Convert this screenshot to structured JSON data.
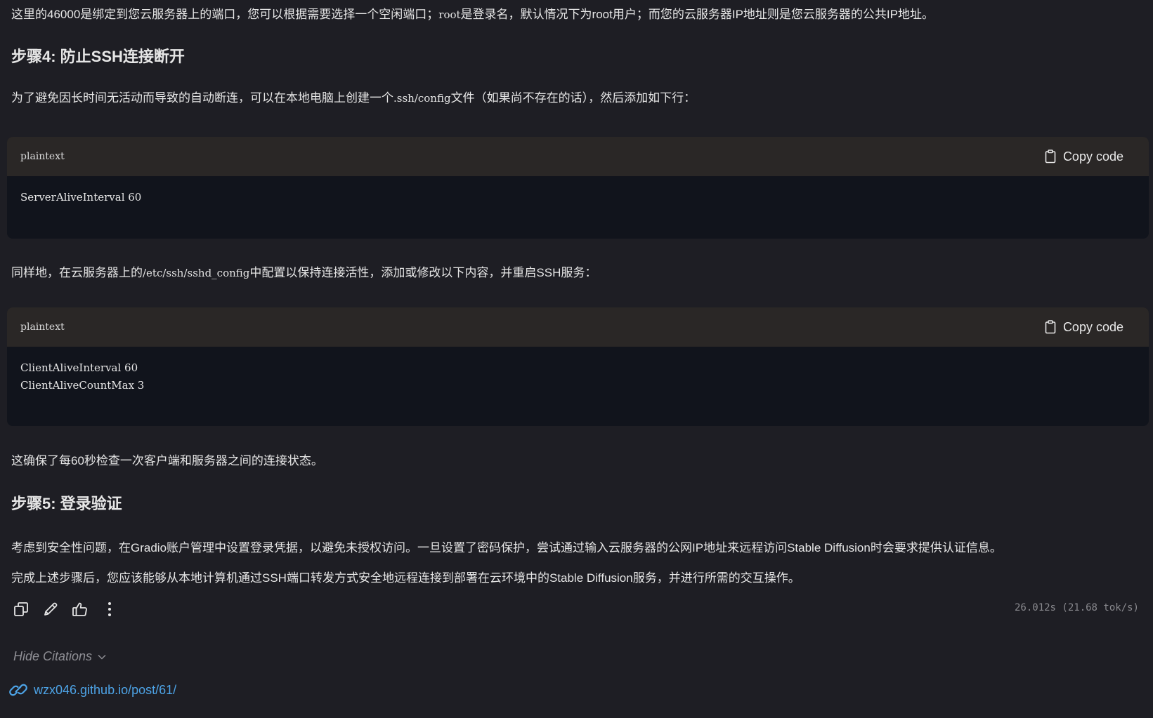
{
  "intro": {
    "text_a": "这里的46000是绑定到您云服务器上的端口，您可以根据需要选择一个空闲端口；",
    "code_root": "root",
    "text_b": "是登录名，默认情况下为root用户；而您的云服务器IP地址则是您云服务器的公共IP地址。"
  },
  "step4": {
    "heading": "步骤4: 防止SSH连接断开",
    "para_a": "为了避免因长时间无活动而导致的自动断连，可以在本地电脑上创建一个",
    "para_code": ".ssh/config",
    "para_b": "文件（如果尚不存在的话），然后添加如下行："
  },
  "codeblock1": {
    "lang": "plaintext",
    "copy_label": "Copy code",
    "code": "ServerAliveInterval 60"
  },
  "server_para": {
    "text_a": "同样地，在云服务器上的",
    "code": "/etc/ssh/sshd_config",
    "text_b": "中配置以保持连接活性，添加或修改以下内容，并重启SSH服务："
  },
  "codeblock2": {
    "lang": "plaintext",
    "copy_label": "Copy code",
    "code": "ClientAliveInterval 60\nClientAliveCountMax 3"
  },
  "ensure_para": "这确保了每60秒检查一次客户端和服务器之间的连接状态。",
  "step5": {
    "heading": "步骤5: 登录验证",
    "para1": "考虑到安全性问题，在Gradio账户管理中设置登录凭据，以避免未授权访问。一旦设置了密码保护，尝试通过输入云服务器的公网IP地址来远程访问Stable Diffusion时会要求提供认证信息。",
    "para2": "完成上述步骤后，您应该能够从本地计算机通过SSH端口转发方式安全地远程连接到部署在云环境中的Stable Diffusion服务，并进行所需的交互操作。"
  },
  "actions": {
    "icons": [
      "copy-icon",
      "edit-icon",
      "thumbs-up-icon",
      "more-icon"
    ],
    "timing": "26.012s (21.68 tok/s)"
  },
  "citations": {
    "toggle_label": "Hide Citations",
    "links": [
      "wzx046.github.io/post/61/"
    ]
  },
  "colors": {
    "background": "#1e1e24",
    "code_header": "#2a2726",
    "code_body": "#11141c",
    "link": "#4da3e6"
  }
}
